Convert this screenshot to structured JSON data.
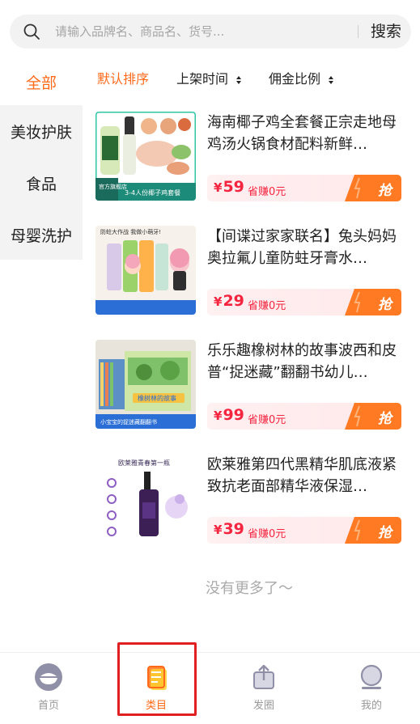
{
  "search": {
    "placeholder": "请输入品牌名、商品名、货号...",
    "button_label": "搜索",
    "icon": "search-icon"
  },
  "sidebar": {
    "items": [
      {
        "label": "全部",
        "active": true
      },
      {
        "label": "美妆护肤",
        "active": false
      },
      {
        "label": "食品",
        "active": false
      },
      {
        "label": "母婴洗护",
        "active": false
      }
    ]
  },
  "sort": {
    "items": [
      {
        "label": "默认排序",
        "active": true
      },
      {
        "label": "上架时间",
        "active": false,
        "icon": "sort-arrows-icon"
      },
      {
        "label": "佣金比例",
        "active": false,
        "icon": "sort-arrows-icon"
      }
    ]
  },
  "products": [
    {
      "title": "海南椰子鸡全套餐正宗走地母鸡汤火锅食材配料新鲜…",
      "currency": "¥",
      "price": "59",
      "earn": "省赚0元",
      "grab_label": "抢",
      "thumb_caption": "3-4人份椰子鸡套餐",
      "thumb_badge": "官方旗舰店"
    },
    {
      "title": "【间谍过家家联名】兔头妈妈奥拉氟儿童防蛀牙膏水…",
      "currency": "¥",
      "price": "29",
      "earn": "省赚0元",
      "grab_label": "抢",
      "thumb_caption": "防蛀大作战 我做小萌牙!",
      "thumb_badge": ""
    },
    {
      "title": "乐乐趣橡树林的故事波西和皮普“捉迷藏”翻翻书幼儿…",
      "currency": "¥",
      "price": "99",
      "earn": "省赚0元",
      "grab_label": "抢",
      "thumb_caption": "橡树林的故事",
      "thumb_badge": "小宝宝的捉迷藏翻翻书"
    },
    {
      "title": "欧莱雅第四代黑精华肌底液紧致抗老面部精华液保湿…",
      "currency": "¥",
      "price": "39",
      "earn": "省赚0元",
      "grab_label": "抢",
      "thumb_caption": "欧莱雅青春第一瓶",
      "thumb_badge": ""
    }
  ],
  "footer_text": "没有更多了～",
  "tabbar": {
    "items": [
      {
        "label": "首页",
        "icon": "home-bowl-icon",
        "active": false
      },
      {
        "label": "类目",
        "icon": "category-list-icon",
        "active": true
      },
      {
        "label": "发圈",
        "icon": "share-icon",
        "active": false
      },
      {
        "label": "我的",
        "icon": "profile-icon",
        "active": false
      }
    ]
  },
  "colors": {
    "accent": "#ff6a1a",
    "price": "#f5243f",
    "highlight_box": "#e02020"
  }
}
